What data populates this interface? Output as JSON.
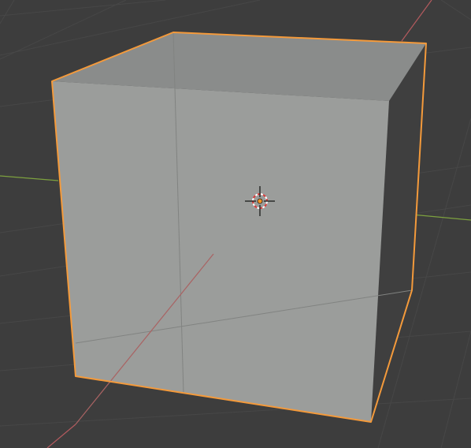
{
  "viewport": {
    "background": "#3d3d3d",
    "grid_color": "#474747",
    "x_axis_color": "#b35a5e",
    "y_axis_color": "#7da13f"
  },
  "object": {
    "type": "cube",
    "selected": true,
    "outline_color": "#f49a3b",
    "front_face_color": "#9b9d9b",
    "top_face_color": "#8a8c8b",
    "side_face_color": "#3f3f3f",
    "wire_color": "#818381"
  },
  "cursor": {
    "icon": "3d-cursor-icon",
    "origin_color": "#ff9422"
  }
}
